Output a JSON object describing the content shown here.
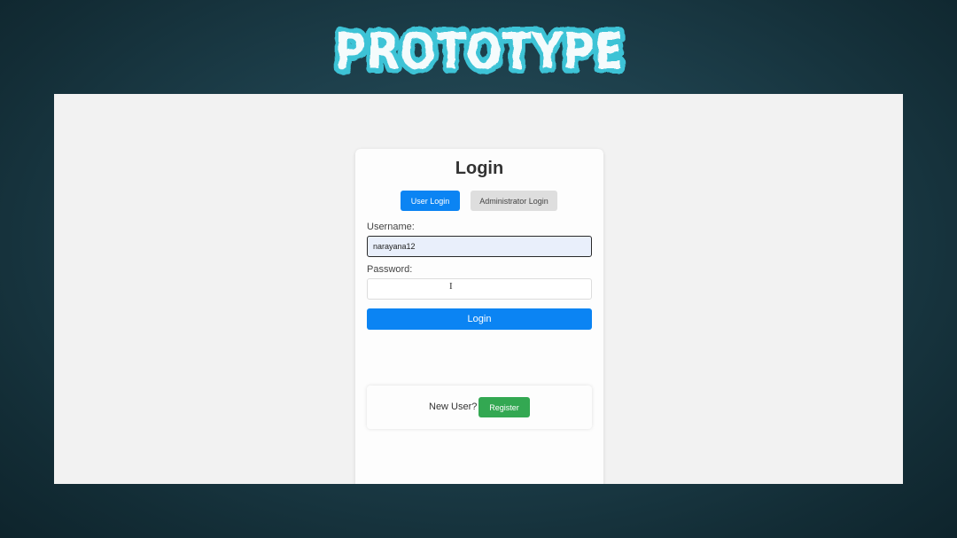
{
  "banner": {
    "title": "PROTOTYPE"
  },
  "login": {
    "title": "Login",
    "tabs": [
      {
        "label": "User Login",
        "active": true
      },
      {
        "label": "Administrator Login",
        "active": false
      }
    ],
    "username": {
      "label": "Username:",
      "value": "narayana12"
    },
    "password": {
      "label": "Password:",
      "value": ""
    },
    "submit_label": "Login",
    "register": {
      "prompt": "New User?",
      "button_label": "Register"
    }
  },
  "colors": {
    "primary": "#0b84f3",
    "success": "#33a852",
    "banner_text": "#3ec3d6",
    "background": "#1d3f4b"
  },
  "icons": {
    "cursor": "text-cursor-icon"
  }
}
